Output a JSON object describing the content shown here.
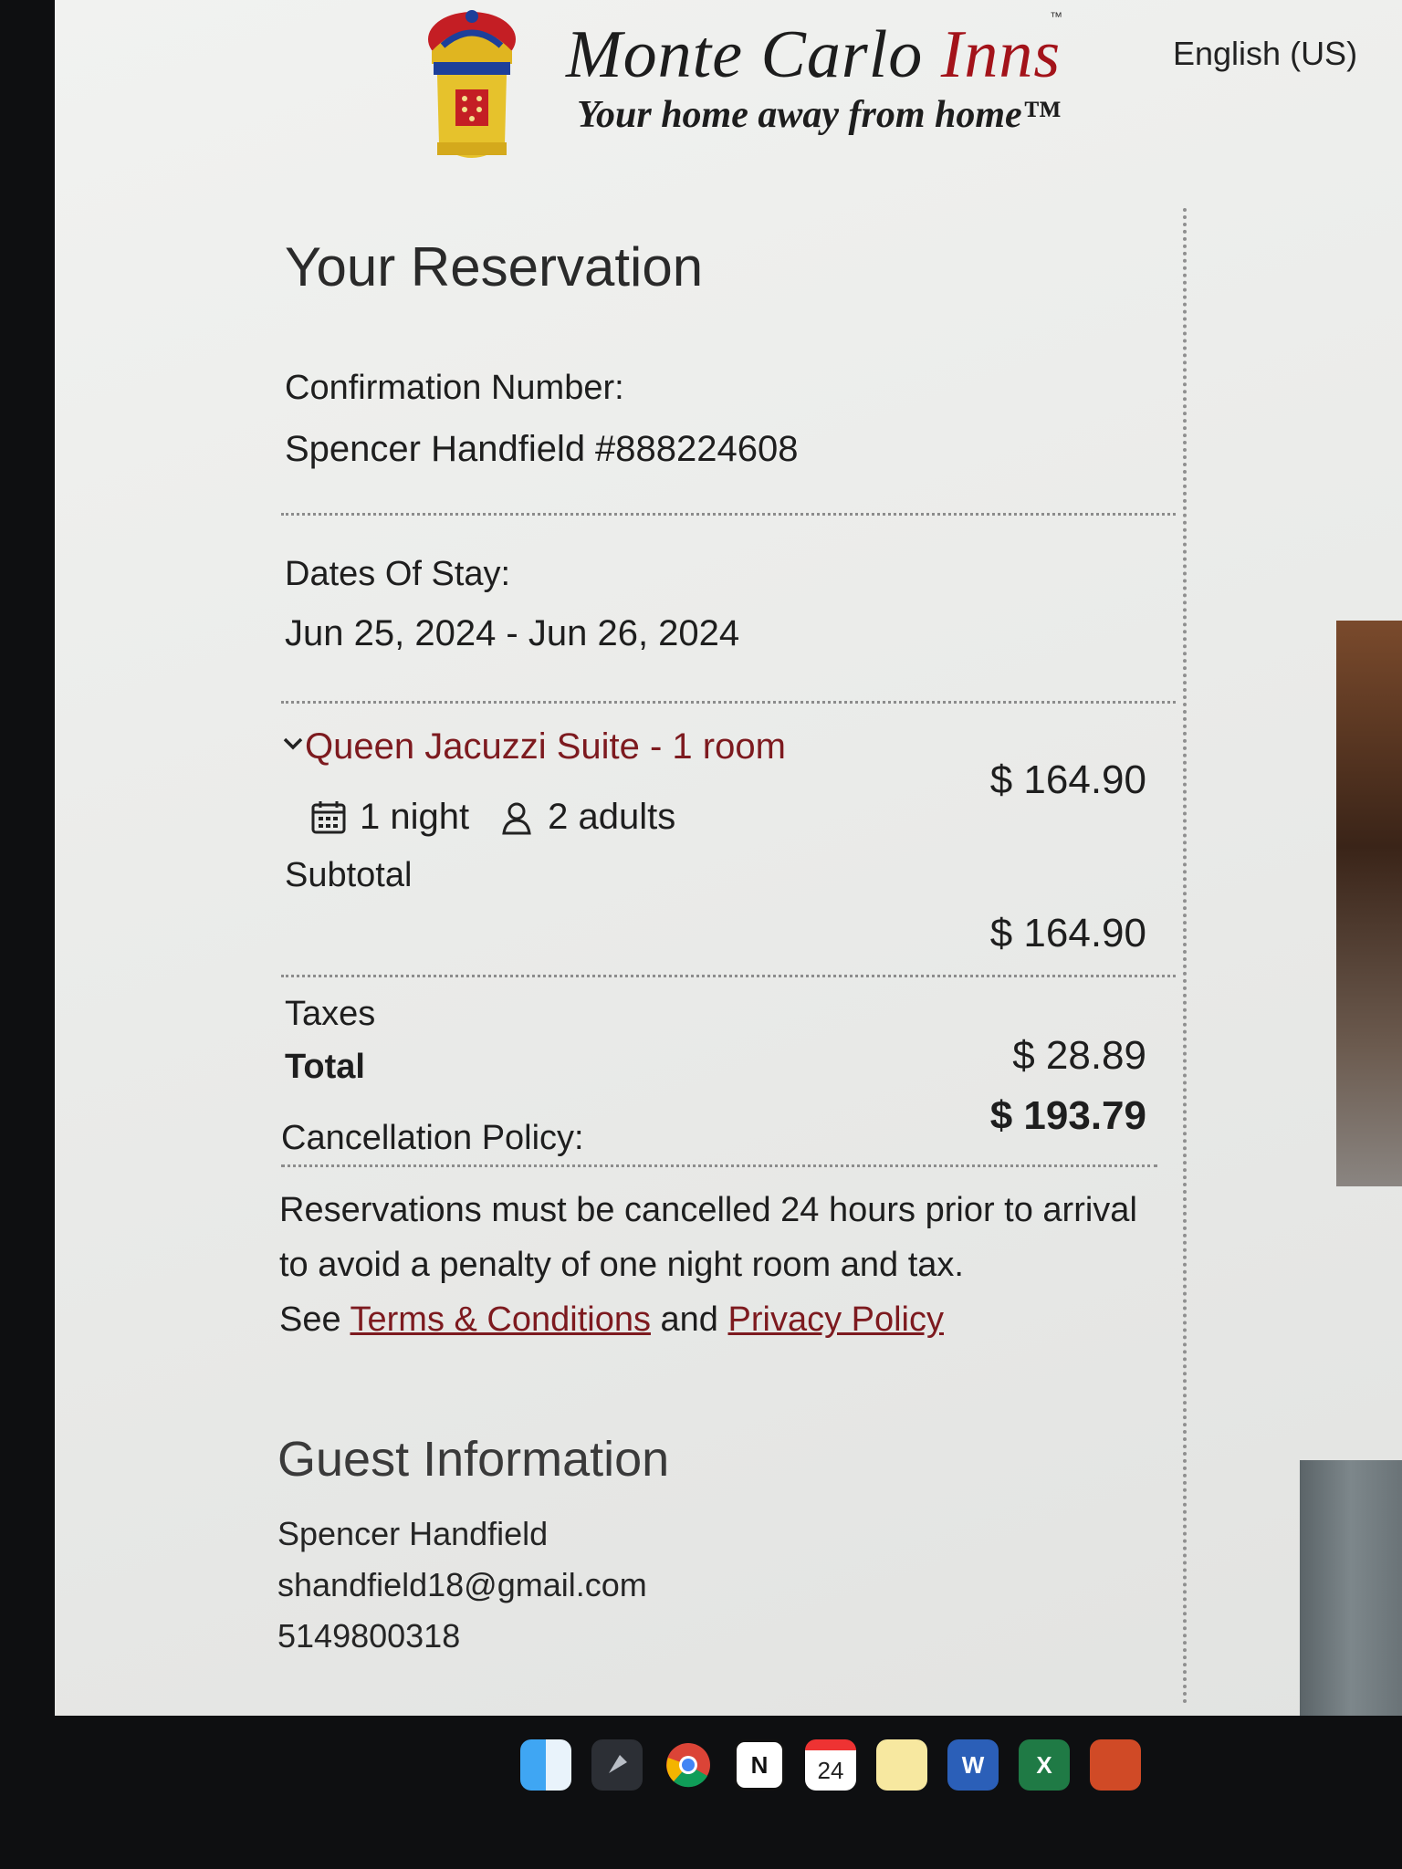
{
  "header": {
    "brand_name_1": "Monte Carlo",
    "brand_name_2": "Inns",
    "tm": "™",
    "tagline": "Your home away from home™",
    "language": "English (US)"
  },
  "reservation": {
    "title": "Your Reservation",
    "confirmation_label": "Confirmation Number:",
    "guest_name": "Spencer Handfield",
    "confirmation_number": "#888224608",
    "dates_label": "Dates Of Stay:",
    "dates_value": "Jun 25, 2024 - Jun 26, 2024",
    "room_name": "Queen Jacuzzi Suite - 1 room",
    "room_price": "$ 164.90",
    "nights": "1 night",
    "adults": "2 adults",
    "subtotal_label": "Subtotal",
    "subtotal_value": "$ 164.90",
    "taxes_label": "Taxes",
    "taxes_value": "$ 28.89",
    "total_label": "Total",
    "total_value": "$ 193.79",
    "cancellation_label": "Cancellation Policy:",
    "cancellation_text": "Reservations must be cancelled 24 hours prior to arrival to avoid a penalty of one night room and tax.",
    "see_text": "See",
    "terms_link": "Terms & Conditions",
    "and_text": "and",
    "privacy_link": "Privacy Policy"
  },
  "guest": {
    "title": "Guest Information",
    "name": "Spencer Handfield",
    "email": "shandfield18@gmail.com",
    "phone": "5149800318"
  },
  "dock": {
    "calendar_day": "24",
    "word_letter": "W",
    "excel_letter": "X",
    "notion_letter": "N"
  },
  "colors": {
    "accent": "#7d1a1f",
    "brand_red": "#a3131a"
  }
}
